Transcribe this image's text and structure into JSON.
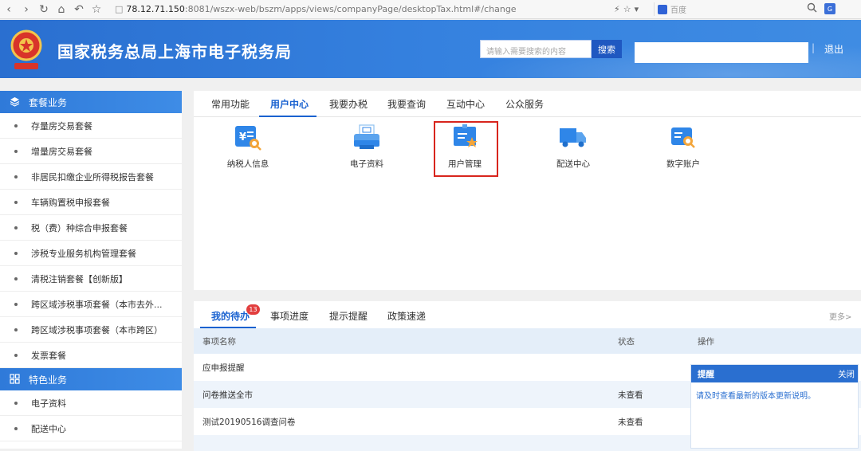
{
  "browser": {
    "url_host": "78.12.71.150",
    "url_rest": ":8081/wszx-web/bszm/apps/views/companyPage/desktopTax.html#/change",
    "search_placeholder": "百度"
  },
  "header": {
    "title": "国家税务总局上海市电子税务局",
    "search_placeholder": "请输入需要搜索的内容",
    "search_button": "搜索",
    "separator": "|",
    "logout": "退出",
    "accent_color": "#2a6fd0"
  },
  "sidebar": {
    "sections": [
      {
        "title": "套餐业务",
        "items": [
          "存量房交易套餐",
          "增量房交易套餐",
          "非居民扣缴企业所得税报告套餐",
          "车辆购置税申报套餐",
          "税（费）种综合申报套餐",
          "涉税专业服务机构管理套餐",
          "清税注销套餐【创新版】",
          "跨区域涉税事项套餐（本市去外...",
          "跨区域涉税事项套餐（本市跨区）",
          "发票套餐"
        ]
      },
      {
        "title": "特色业务",
        "items": [
          "电子资料",
          "配送中心"
        ]
      }
    ]
  },
  "main_tabs": [
    "常用功能",
    "用户中心",
    "我要办税",
    "我要查询",
    "互动中心",
    "公众服务"
  ],
  "functions": [
    {
      "label": "纳税人信息",
      "icon": "tax-id-card-icon"
    },
    {
      "label": "电子资料",
      "icon": "printer-icon"
    },
    {
      "label": "用户管理",
      "icon": "user-manage-icon"
    },
    {
      "label": "配送中心",
      "icon": "delivery-truck-icon"
    },
    {
      "label": "数字账户",
      "icon": "digital-account-icon"
    }
  ],
  "todo": {
    "tabs": [
      "我的待办",
      "事项进度",
      "提示提醒",
      "政策速递"
    ],
    "badge": "13",
    "more": "更多>",
    "columns": [
      "事项名称",
      "状态",
      "操作"
    ],
    "rows": [
      {
        "name": "应申报提醒",
        "status": ""
      },
      {
        "name": "问卷推送全市",
        "status": "未查看"
      },
      {
        "name": "测试20190516调查问卷",
        "status": "未查看"
      }
    ]
  },
  "popup": {
    "title": "提醒",
    "close": "关闭",
    "message": "请及时查看最新的版本更新说明。"
  }
}
